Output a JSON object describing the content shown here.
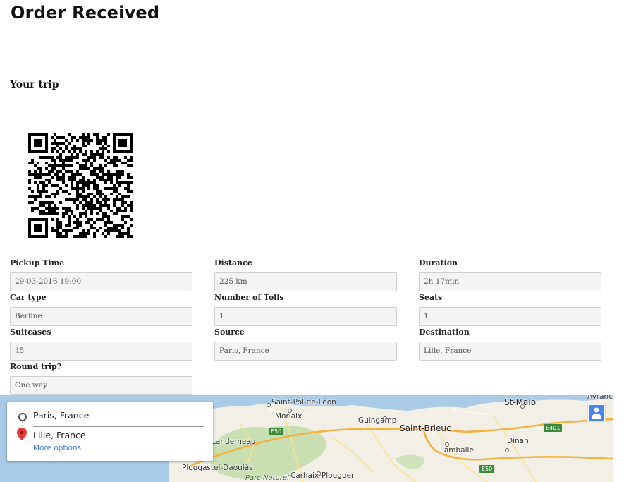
{
  "page": {
    "title": "Order Received",
    "subtitle": "Your trip"
  },
  "fields": [
    {
      "label": "Pickup Time",
      "value": "29-03-2016 19:00"
    },
    {
      "label": "Distance",
      "value": "225 km"
    },
    {
      "label": "Duration",
      "value": "2h 17min"
    },
    {
      "label": "Car type",
      "value": "Berline"
    },
    {
      "label": "Number of Tolls",
      "value": "1"
    },
    {
      "label": "Seats",
      "value": "1"
    },
    {
      "label": "Suitcases",
      "value": "45"
    },
    {
      "label": "Source",
      "value": "Paris, France"
    },
    {
      "label": "Destination",
      "value": "Lille, France"
    },
    {
      "label": "Round trip?",
      "value": "One way"
    }
  ],
  "map": {
    "directions": {
      "origin": "Paris, France",
      "destination": "Lille, France",
      "more_options": "More options"
    },
    "places": [
      "Saint-Pol-de-Léon",
      "Morlaix",
      "Guingamp",
      "Saint-Brieuc",
      "St-Malo",
      "Avranch",
      "Landerneau",
      "Lamballe",
      "Dinan",
      "Plougastel-Daoulas",
      "Parc Naturel",
      "Carhaix-Plouguer"
    ],
    "roads": [
      "E50",
      "E401",
      "E50"
    ],
    "icons": {
      "street_view": "pegman-icon",
      "origin": "circle-icon",
      "destination": "map-pin-icon"
    }
  },
  "colors": {
    "water": "#a9cbe8",
    "land": "#f2efe6",
    "forest": "#c9dfb2",
    "highway": "#f6b03c",
    "pin": "#e53935",
    "link": "#3b78d8"
  }
}
